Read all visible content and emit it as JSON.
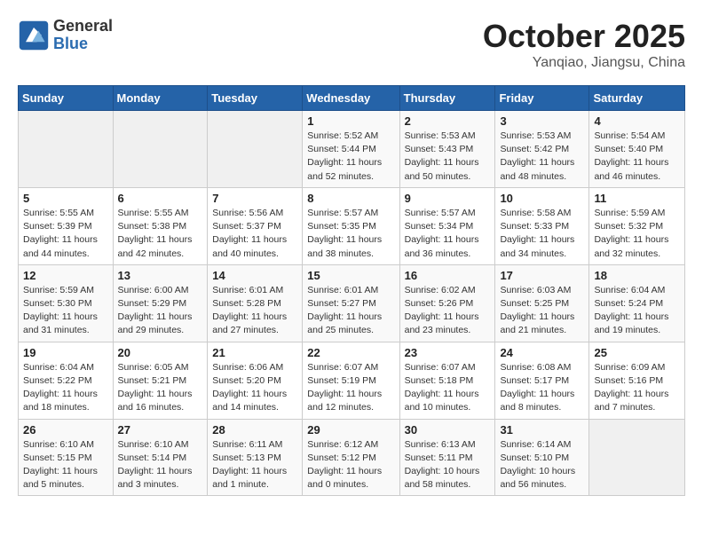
{
  "header": {
    "logo_general": "General",
    "logo_blue": "Blue",
    "month": "October 2025",
    "location": "Yanqiao, Jiangsu, China"
  },
  "days_of_week": [
    "Sunday",
    "Monday",
    "Tuesday",
    "Wednesday",
    "Thursday",
    "Friday",
    "Saturday"
  ],
  "weeks": [
    [
      {
        "day": "",
        "info": ""
      },
      {
        "day": "",
        "info": ""
      },
      {
        "day": "",
        "info": ""
      },
      {
        "day": "1",
        "info": "Sunrise: 5:52 AM\nSunset: 5:44 PM\nDaylight: 11 hours\nand 52 minutes."
      },
      {
        "day": "2",
        "info": "Sunrise: 5:53 AM\nSunset: 5:43 PM\nDaylight: 11 hours\nand 50 minutes."
      },
      {
        "day": "3",
        "info": "Sunrise: 5:53 AM\nSunset: 5:42 PM\nDaylight: 11 hours\nand 48 minutes."
      },
      {
        "day": "4",
        "info": "Sunrise: 5:54 AM\nSunset: 5:40 PM\nDaylight: 11 hours\nand 46 minutes."
      }
    ],
    [
      {
        "day": "5",
        "info": "Sunrise: 5:55 AM\nSunset: 5:39 PM\nDaylight: 11 hours\nand 44 minutes."
      },
      {
        "day": "6",
        "info": "Sunrise: 5:55 AM\nSunset: 5:38 PM\nDaylight: 11 hours\nand 42 minutes."
      },
      {
        "day": "7",
        "info": "Sunrise: 5:56 AM\nSunset: 5:37 PM\nDaylight: 11 hours\nand 40 minutes."
      },
      {
        "day": "8",
        "info": "Sunrise: 5:57 AM\nSunset: 5:35 PM\nDaylight: 11 hours\nand 38 minutes."
      },
      {
        "day": "9",
        "info": "Sunrise: 5:57 AM\nSunset: 5:34 PM\nDaylight: 11 hours\nand 36 minutes."
      },
      {
        "day": "10",
        "info": "Sunrise: 5:58 AM\nSunset: 5:33 PM\nDaylight: 11 hours\nand 34 minutes."
      },
      {
        "day": "11",
        "info": "Sunrise: 5:59 AM\nSunset: 5:32 PM\nDaylight: 11 hours\nand 32 minutes."
      }
    ],
    [
      {
        "day": "12",
        "info": "Sunrise: 5:59 AM\nSunset: 5:30 PM\nDaylight: 11 hours\nand 31 minutes."
      },
      {
        "day": "13",
        "info": "Sunrise: 6:00 AM\nSunset: 5:29 PM\nDaylight: 11 hours\nand 29 minutes."
      },
      {
        "day": "14",
        "info": "Sunrise: 6:01 AM\nSunset: 5:28 PM\nDaylight: 11 hours\nand 27 minutes."
      },
      {
        "day": "15",
        "info": "Sunrise: 6:01 AM\nSunset: 5:27 PM\nDaylight: 11 hours\nand 25 minutes."
      },
      {
        "day": "16",
        "info": "Sunrise: 6:02 AM\nSunset: 5:26 PM\nDaylight: 11 hours\nand 23 minutes."
      },
      {
        "day": "17",
        "info": "Sunrise: 6:03 AM\nSunset: 5:25 PM\nDaylight: 11 hours\nand 21 minutes."
      },
      {
        "day": "18",
        "info": "Sunrise: 6:04 AM\nSunset: 5:24 PM\nDaylight: 11 hours\nand 19 minutes."
      }
    ],
    [
      {
        "day": "19",
        "info": "Sunrise: 6:04 AM\nSunset: 5:22 PM\nDaylight: 11 hours\nand 18 minutes."
      },
      {
        "day": "20",
        "info": "Sunrise: 6:05 AM\nSunset: 5:21 PM\nDaylight: 11 hours\nand 16 minutes."
      },
      {
        "day": "21",
        "info": "Sunrise: 6:06 AM\nSunset: 5:20 PM\nDaylight: 11 hours\nand 14 minutes."
      },
      {
        "day": "22",
        "info": "Sunrise: 6:07 AM\nSunset: 5:19 PM\nDaylight: 11 hours\nand 12 minutes."
      },
      {
        "day": "23",
        "info": "Sunrise: 6:07 AM\nSunset: 5:18 PM\nDaylight: 11 hours\nand 10 minutes."
      },
      {
        "day": "24",
        "info": "Sunrise: 6:08 AM\nSunset: 5:17 PM\nDaylight: 11 hours\nand 8 minutes."
      },
      {
        "day": "25",
        "info": "Sunrise: 6:09 AM\nSunset: 5:16 PM\nDaylight: 11 hours\nand 7 minutes."
      }
    ],
    [
      {
        "day": "26",
        "info": "Sunrise: 6:10 AM\nSunset: 5:15 PM\nDaylight: 11 hours\nand 5 minutes."
      },
      {
        "day": "27",
        "info": "Sunrise: 6:10 AM\nSunset: 5:14 PM\nDaylight: 11 hours\nand 3 minutes."
      },
      {
        "day": "28",
        "info": "Sunrise: 6:11 AM\nSunset: 5:13 PM\nDaylight: 11 hours\nand 1 minute."
      },
      {
        "day": "29",
        "info": "Sunrise: 6:12 AM\nSunset: 5:12 PM\nDaylight: 11 hours\nand 0 minutes."
      },
      {
        "day": "30",
        "info": "Sunrise: 6:13 AM\nSunset: 5:11 PM\nDaylight: 10 hours\nand 58 minutes."
      },
      {
        "day": "31",
        "info": "Sunrise: 6:14 AM\nSunset: 5:10 PM\nDaylight: 10 hours\nand 56 minutes."
      },
      {
        "day": "",
        "info": ""
      }
    ]
  ]
}
